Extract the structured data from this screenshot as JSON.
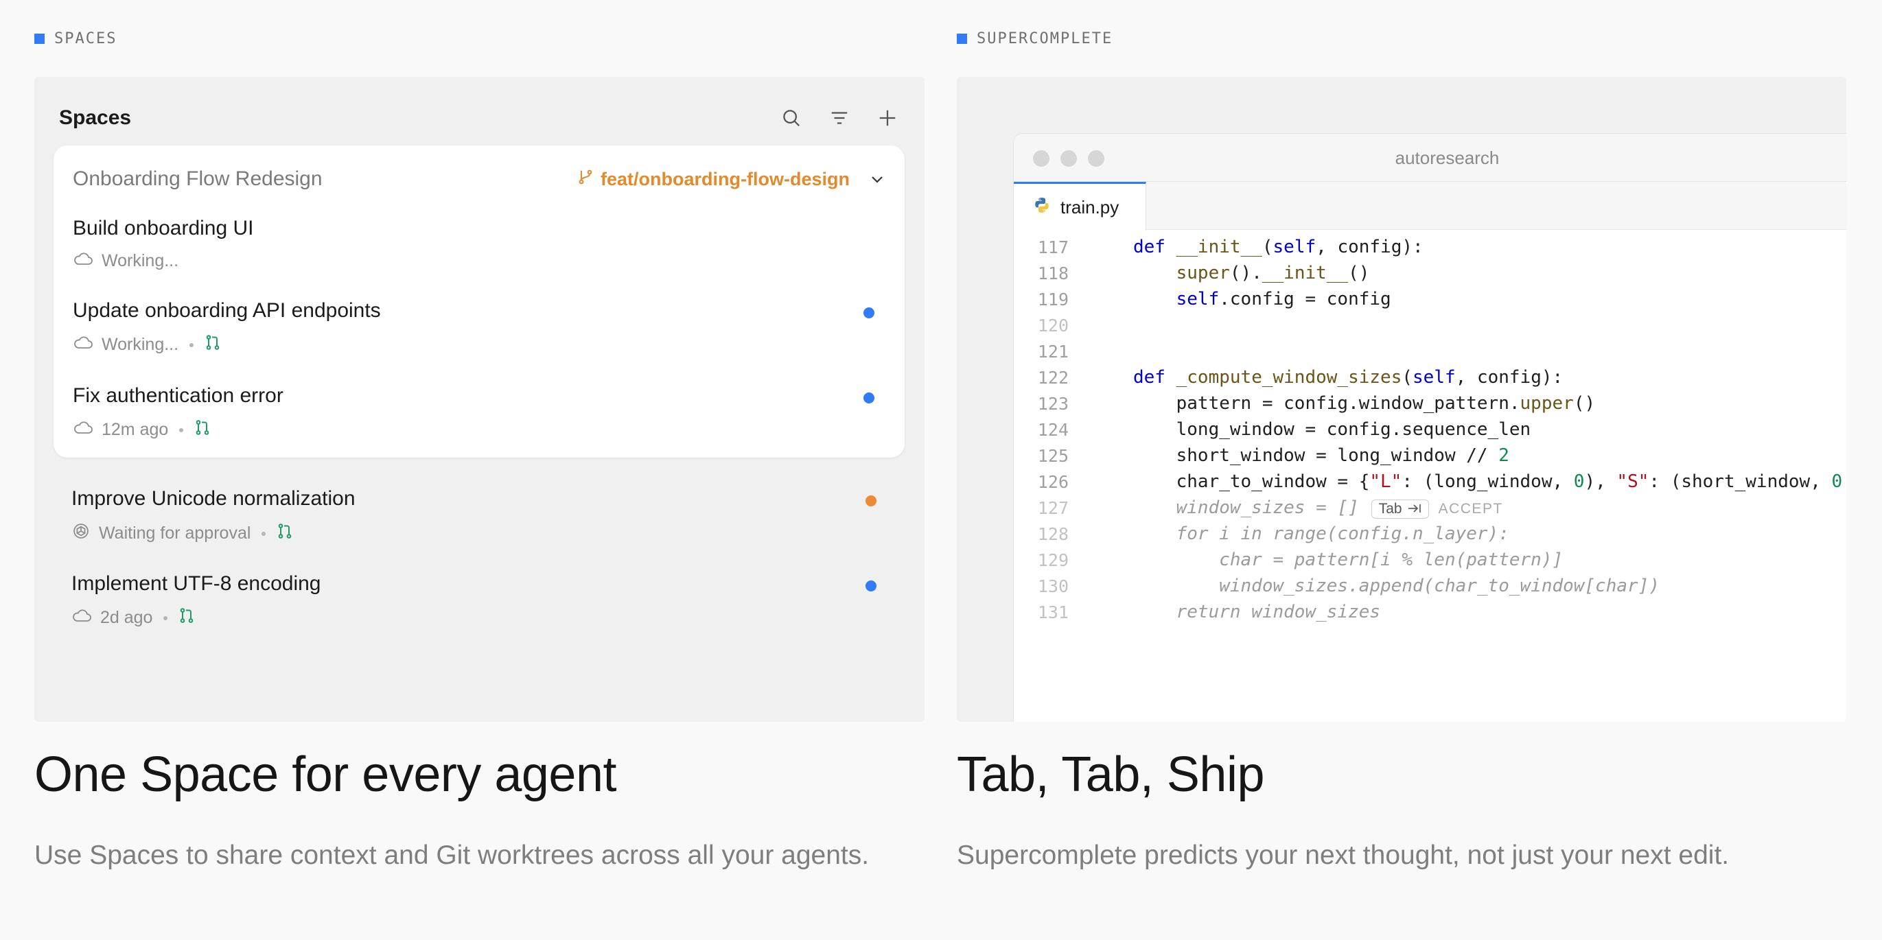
{
  "left_section": {
    "label": "SPACES",
    "panel_title": "Spaces",
    "group": {
      "title": "Onboarding Flow Redesign",
      "branch": "feat/onboarding-flow-design"
    },
    "tasks": [
      {
        "title": "Build onboarding UI",
        "status": "Working...",
        "dot": null,
        "pr": false
      },
      {
        "title": "Update onboarding API endpoints",
        "status": "Working...",
        "dot": "#2f7cf6",
        "pr": true
      },
      {
        "title": "Fix authentication error",
        "status": "12m ago",
        "dot": "#2f7cf6",
        "pr": true
      },
      {
        "title": "Improve Unicode normalization",
        "status": "Waiting for approval",
        "dot": "#ee8a35",
        "pr": true
      },
      {
        "title": "Implement UTF-8 encoding",
        "status": "2d ago",
        "dot": "#2f7cf6",
        "pr": true
      }
    ],
    "headline": "One Space for every agent",
    "description": "Use Spaces to share context and Git worktrees across all your agents."
  },
  "right_section": {
    "label": "SUPERCOMPLETE",
    "window_title": "autoresearch",
    "tab_name": "train.py",
    "line_numbers": [
      "117",
      "118",
      "119",
      "120",
      "121",
      "122",
      "123",
      "124",
      "125",
      "126",
      "127",
      "128",
      "129",
      "130",
      "131"
    ],
    "accept_key": "Tab",
    "accept_label": "ACCEPT",
    "headline": "Tab, Tab, Ship",
    "description": "Supercomplete predicts your next thought, not just your next edit."
  },
  "colors": {
    "accent_blue": "#2f7cf6",
    "branch_orange": "#e38a2d",
    "pr_green": "#1f9a67",
    "status_orange": "#ee8a35"
  }
}
